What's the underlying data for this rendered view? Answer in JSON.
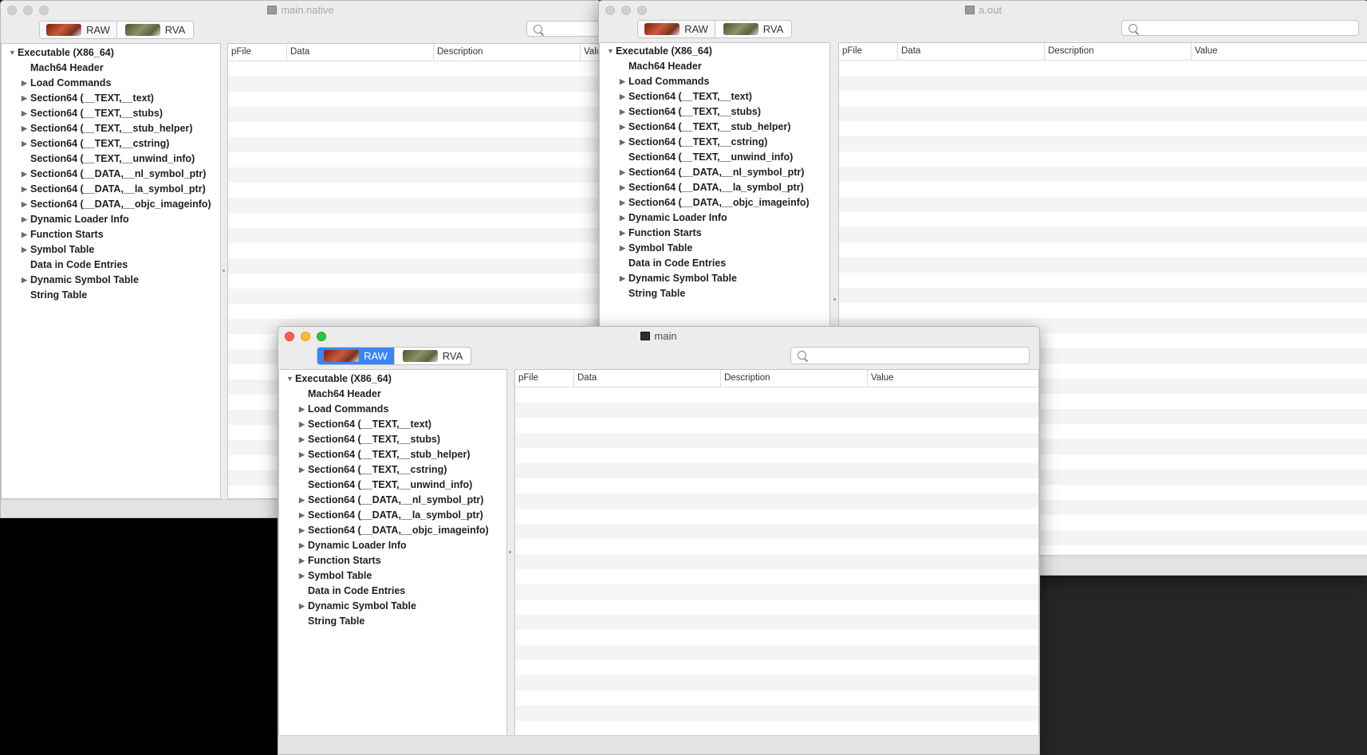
{
  "segments": {
    "raw_label": "RAW",
    "rva_label": "RVA"
  },
  "columns": {
    "pfile": "pFile",
    "data": "Data",
    "description": "Description",
    "value": "Value"
  },
  "windows": {
    "native": {
      "title": "main.native",
      "columns": {
        "value": "Valu"
      }
    },
    "aout": {
      "title": "a.out"
    },
    "main": {
      "title": "main"
    }
  },
  "tree": [
    {
      "label": "Executable  (X86_64)",
      "expanded": true
    },
    {
      "label": "Mach64 Header"
    },
    {
      "label": "Load Commands",
      "expandable": true
    },
    {
      "label": "Section64 (__TEXT,__text)",
      "expandable": true
    },
    {
      "label": "Section64 (__TEXT,__stubs)",
      "expandable": true
    },
    {
      "label": "Section64 (__TEXT,__stub_helper)",
      "expandable": true
    },
    {
      "label": "Section64 (__TEXT,__cstring)",
      "expandable": true
    },
    {
      "label": "Section64 (__TEXT,__unwind_info)"
    },
    {
      "label": "Section64 (__DATA,__nl_symbol_ptr)",
      "expandable": true
    },
    {
      "label": "Section64 (__DATA,__la_symbol_ptr)",
      "expandable": true
    },
    {
      "label": "Section64 (__DATA,__objc_imageinfo)",
      "expandable": true
    },
    {
      "label": "Dynamic Loader Info",
      "expandable": true
    },
    {
      "label": "Function Starts",
      "expandable": true
    },
    {
      "label": "Symbol Table",
      "expandable": true
    },
    {
      "label": "Data in Code Entries"
    },
    {
      "label": "Dynamic Symbol Table",
      "expandable": true
    },
    {
      "label": "String Table"
    }
  ],
  "search": {
    "placeholder": "",
    "value": ""
  }
}
